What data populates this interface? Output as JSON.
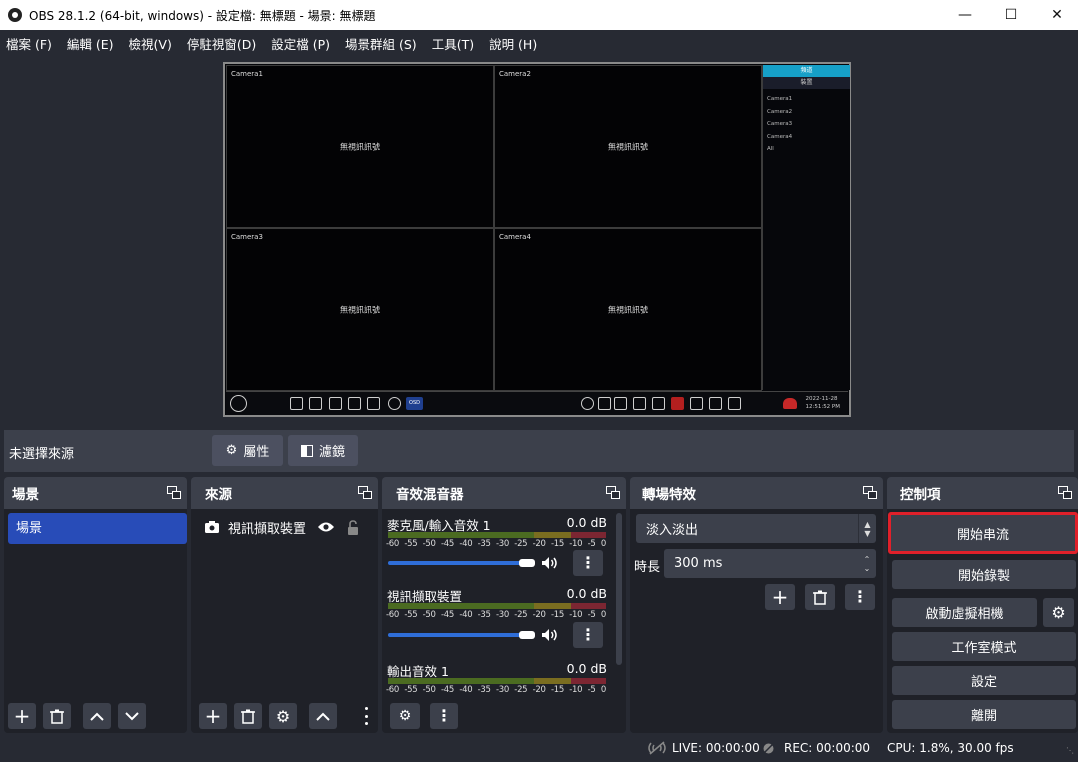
{
  "window": {
    "title": "OBS 28.1.2 (64-bit, windows) - 設定檔: 無標題 - 場景: 無標題"
  },
  "menu": [
    "檔案 (F)",
    "編輯 (E)",
    "檢視(V)",
    "停駐視窗(D)",
    "設定檔 (P)",
    "場景群組 (S)",
    "工具(T)",
    "說明 (H)"
  ],
  "preview": {
    "cameras": [
      {
        "name": "Camera1",
        "status": "無視訊訊號"
      },
      {
        "name": "Camera2",
        "status": "無視訊訊號"
      },
      {
        "name": "Camera3",
        "status": "無視訊訊號"
      },
      {
        "name": "Camera4",
        "status": "無視訊訊號"
      }
    ],
    "side_tab_active": "頻道",
    "side_tab_other": "裝置",
    "side_items": [
      "Camera1",
      "Camera2",
      "Camera3",
      "Camera4",
      "All"
    ],
    "osd_label": "OSD",
    "date": "2022-11-28",
    "time": "12:51:52 PM"
  },
  "source_bar": {
    "no_source": "未選擇來源",
    "properties": "屬性",
    "filters": "濾鏡"
  },
  "scenes": {
    "title": "場景",
    "items": [
      "場景"
    ]
  },
  "sources": {
    "title": "來源",
    "items": [
      {
        "name": "視訊擷取裝置",
        "icon": "camera-icon"
      }
    ]
  },
  "mixer": {
    "title": "音效混音器",
    "ticks": [
      "-60",
      "-55",
      "-50",
      "-45",
      "-40",
      "-35",
      "-30",
      "-25",
      "-20",
      "-15",
      "-10",
      "-5",
      "0"
    ],
    "channels": [
      {
        "name": "麥克風/輸入音效 1",
        "db": "0.0 dB"
      },
      {
        "name": "視訊擷取裝置",
        "db": "0.0 dB"
      },
      {
        "name": "輸出音效 1",
        "db": "0.0 dB"
      }
    ]
  },
  "transitions": {
    "title": "轉場特效",
    "selected": "淡入淡出",
    "duration_label": "時長",
    "duration_value": "300 ms"
  },
  "controls": {
    "title": "控制項",
    "start_streaming": "開始串流",
    "start_recording": "開始錄製",
    "start_virtual_camera": "啟動虛擬相機",
    "studio_mode": "工作室模式",
    "settings": "設定",
    "exit": "離開"
  },
  "status": {
    "live": "LIVE: 00:00:00",
    "rec": "REC: 00:00:00",
    "cpu": "CPU: 1.8%, 30.00 fps"
  },
  "colors": {
    "accent": "#284cb8",
    "highlight": "#e0202a",
    "slider": "#2f6ed8"
  }
}
